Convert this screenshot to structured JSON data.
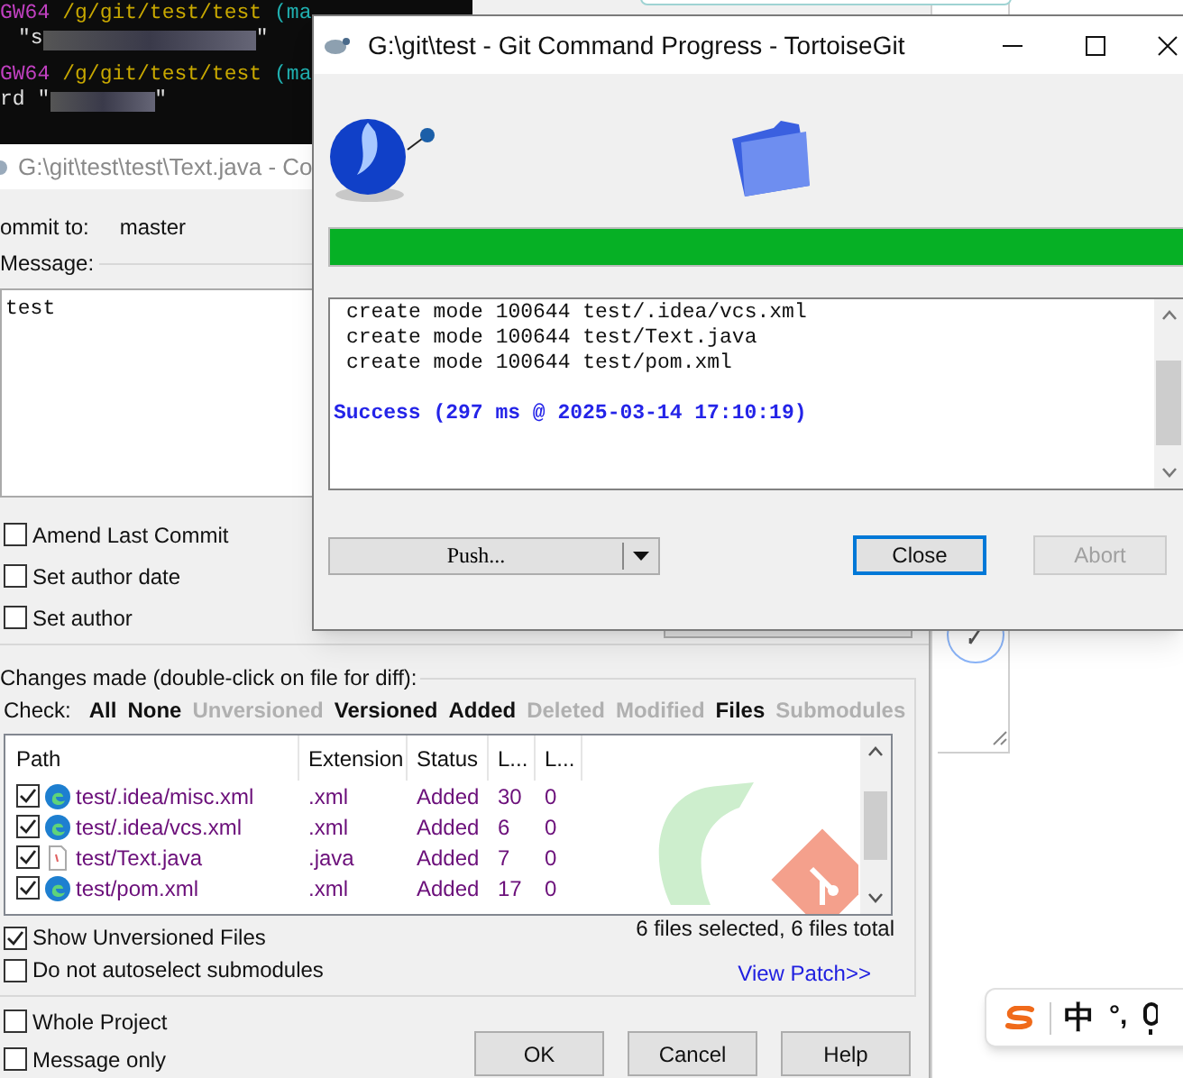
{
  "terminal": {
    "lines": [
      {
        "kind": "prompt",
        "host": "GW64",
        "path": "/g/git/test/test",
        "branch": "(ma"
      },
      {
        "kind": "redacted",
        "before": "\"s",
        "after": "\""
      },
      {
        "kind": "prompt",
        "host": "GW64",
        "path": "/g/git/test/test",
        "branch": "(ma"
      },
      {
        "kind": "redacted",
        "before": "rd \"",
        "after": "\""
      }
    ]
  },
  "commit_window": {
    "title": "G:\\git\\test\\test\\Text.java - Co",
    "commit_to_label": "ommit to:",
    "branch": "master",
    "message_label": "Message:",
    "message": "test",
    "options": [
      {
        "label": "Amend Last Commit",
        "checked": false
      },
      {
        "label": "Set author date",
        "checked": false
      },
      {
        "label": "Set author",
        "checked": false
      }
    ],
    "changes_label": "Changes made (double-click on file for diff):",
    "check_label": "Check:",
    "filters": [
      {
        "label": "All",
        "disabled": false
      },
      {
        "label": "None",
        "disabled": false
      },
      {
        "label": "Unversioned",
        "disabled": true
      },
      {
        "label": "Versioned",
        "disabled": false
      },
      {
        "label": "Added",
        "disabled": false
      },
      {
        "label": "Deleted",
        "disabled": true
      },
      {
        "label": "Modified",
        "disabled": true
      },
      {
        "label": "Files",
        "disabled": false
      },
      {
        "label": "Submodules",
        "disabled": true
      }
    ],
    "file_list": {
      "columns": [
        "Path",
        "Extension",
        "Status",
        "L...",
        "L..."
      ],
      "rows": [
        {
          "checked": true,
          "kind": "app",
          "path": "test/.idea/misc.xml",
          "extension": ".xml",
          "status": "Added",
          "column_4": "30",
          "column_5": "0"
        },
        {
          "checked": true,
          "kind": "app",
          "path": "test/.idea/vcs.xml",
          "extension": ".xml",
          "status": "Added",
          "column_4": "6",
          "column_5": "0"
        },
        {
          "checked": true,
          "kind": "document",
          "path": "test/Text.java",
          "extension": ".java",
          "status": "Added",
          "column_4": "7",
          "column_5": "0"
        },
        {
          "checked": true,
          "kind": "app",
          "path": "test/pom.xml",
          "extension": ".xml",
          "status": "Added",
          "column_4": "17",
          "column_5": "0"
        }
      ]
    },
    "show_unversioned": {
      "label": "Show Unversioned Files",
      "checked": true
    },
    "summary": "6 files selected, 6 files total",
    "no_autoselect": {
      "label": "Do not autoselect submodules",
      "checked": false
    },
    "view_patch": "View Patch>>",
    "bottom_options": [
      {
        "label": "Whole Project",
        "checked": false
      },
      {
        "label": "Message only",
        "checked": false
      }
    ],
    "buttons": [
      "OK",
      "Cancel",
      "Help"
    ]
  },
  "progress_dialog": {
    "title": "G:\\git\\test - Git Command Progress - TortoiseGit",
    "progress": {
      "level": 1
    },
    "log": [
      "create mode 100644 test/.idea/vcs.xml",
      "create mode 100644 test/Text.java",
      "create mode 100644 test/pom.xml"
    ],
    "result": "Success (297 ms @ 2025-03-14 17:10:19)",
    "push_button": "Push...",
    "buttons": [
      {
        "label": "Close",
        "focused": true,
        "disabled": false
      },
      {
        "label": "Abort",
        "focused": false,
        "disabled": true
      }
    ]
  },
  "ime_toolbar": {
    "mode": "中",
    "punctuation": "°,"
  }
}
